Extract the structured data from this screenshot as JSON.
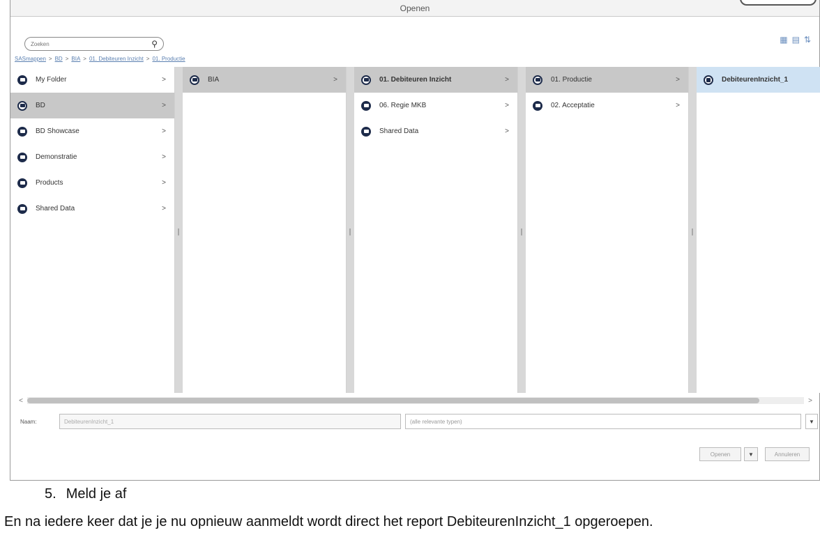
{
  "dialog": {
    "title": "Openen",
    "search": {
      "placeholder": "Zoeken"
    },
    "breadcrumb": [
      "SASmappen",
      "BD",
      "BIA",
      "01. Debiteuren Inzicht",
      "01. Productie"
    ],
    "columns": [
      {
        "items": [
          {
            "label": "My Folder",
            "icon": "folder-icon",
            "selected": false
          },
          {
            "label": "BD",
            "icon": "folder-open-icon",
            "selected": true
          },
          {
            "label": "BD Showcase",
            "icon": "folder-icon",
            "selected": false
          },
          {
            "label": "Demonstratie",
            "icon": "folder-icon",
            "selected": false
          },
          {
            "label": "Products",
            "icon": "folder-icon",
            "selected": false
          },
          {
            "label": "Shared Data",
            "icon": "folder-icon",
            "selected": false
          }
        ]
      },
      {
        "items": [
          {
            "label": "BIA",
            "icon": "folder-open-icon",
            "selected": true
          }
        ]
      },
      {
        "items": [
          {
            "label": "01. Debiteuren Inzicht",
            "icon": "folder-open-icon",
            "selected": true
          },
          {
            "label": "06. Regie MKB",
            "icon": "folder-icon",
            "selected": false
          },
          {
            "label": "Shared Data",
            "icon": "folder-icon",
            "selected": false
          }
        ]
      },
      {
        "items": [
          {
            "label": "01. Productie",
            "icon": "folder-open-icon",
            "selected": true
          },
          {
            "label": "02. Acceptatie",
            "icon": "folder-icon",
            "selected": false
          }
        ]
      },
      {
        "items": [
          {
            "label": "DebiteurenInzicht_1",
            "icon": "report-icon",
            "selected": true
          }
        ]
      }
    ],
    "name_label": "Naam:",
    "name_value": "DebiteurenInzicht_1",
    "filter_value": "(alle relevante typen)",
    "open_button": "Openen",
    "cancel_button": "Annuleren",
    "chevron": ">"
  },
  "document": {
    "step_number": "5.",
    "step_text": "Meld je af",
    "paragraph": "En na iedere keer dat je je nu opnieuw aanmeldt wordt direct het report DebiteurenInzicht_1 opgeroepen."
  }
}
